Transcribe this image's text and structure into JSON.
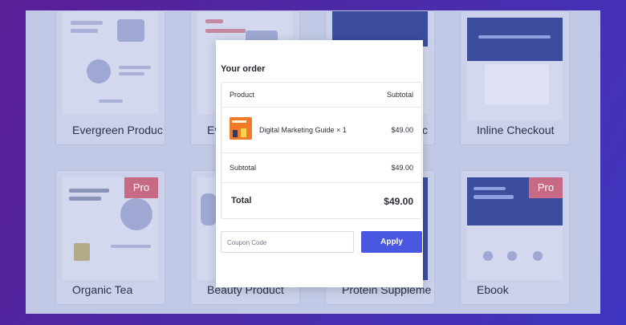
{
  "templates": [
    {
      "title": "Evergreen Produc",
      "pro": ""
    },
    {
      "title": "Ev",
      "pro": ""
    },
    {
      "title": "c",
      "pro": ""
    },
    {
      "title": "Inline Checkout",
      "pro": ""
    },
    {
      "title": "Organic Tea",
      "pro": "Pro"
    },
    {
      "title": "Beauty Product",
      "pro": ""
    },
    {
      "title": "Protein Suppleme",
      "pro": ""
    },
    {
      "title": "Ebook",
      "pro": "Pro"
    }
  ],
  "order": {
    "heading": "Your order",
    "col_product": "Product",
    "col_subtotal": "Subtotal",
    "item_name": "Digital Marketing Guide × 1",
    "item_price": "$49.00",
    "subtotal_label": "Subtotal",
    "subtotal_value": "$49.00",
    "total_label": "Total",
    "total_value": "$49.00"
  },
  "coupon": {
    "placeholder": "Coupon Code",
    "apply_label": "Apply"
  },
  "colors": {
    "accent": "#4a57e0",
    "pro_badge": "#c86a86",
    "product_thumb": "#f07a28"
  }
}
